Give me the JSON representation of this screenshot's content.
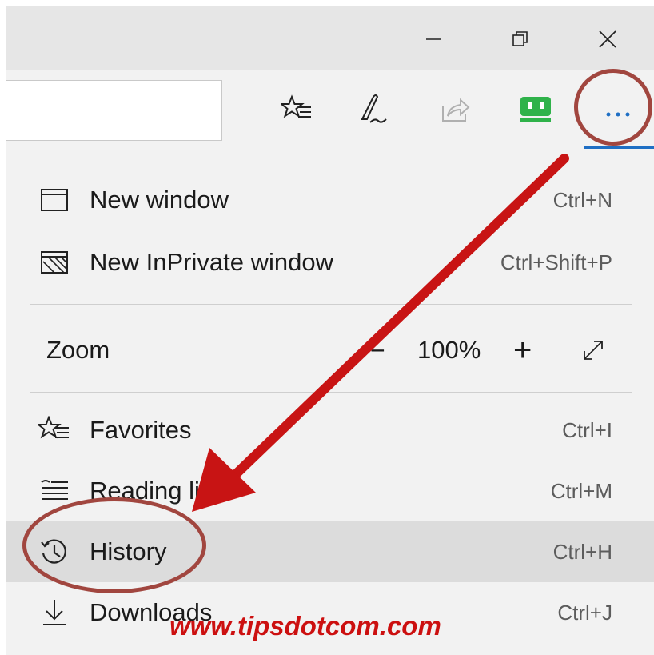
{
  "window_controls": {
    "minimize_icon": "minimize-icon",
    "restore_icon": "restore-icon",
    "close_icon": "close-icon"
  },
  "toolbar": {
    "icons": [
      "favorites-star-icon",
      "pen-note-icon",
      "share-icon",
      "extension-icon",
      "more-actions-icon"
    ],
    "accent_color": "#1f6fc4",
    "extension_color": "#2fb24a"
  },
  "menu": {
    "new_window": {
      "label": "New window",
      "shortcut": "Ctrl+N"
    },
    "new_inprivate": {
      "label": "New InPrivate window",
      "shortcut": "Ctrl+Shift+P"
    },
    "zoom": {
      "label": "Zoom",
      "value": "100%",
      "minus": "−",
      "plus": "+"
    },
    "favorites": {
      "label": "Favorites",
      "shortcut": "Ctrl+I"
    },
    "reading_list": {
      "label": "Reading li",
      "shortcut": "Ctrl+M"
    },
    "history": {
      "label": "History",
      "shortcut": "Ctrl+H"
    },
    "downloads": {
      "label": "Downloads",
      "shortcut": "Ctrl+J"
    }
  },
  "annotation": {
    "arrow_color": "#c81414",
    "oval_color": "#a1463f"
  },
  "watermark": "www.tipsdotcom.com"
}
